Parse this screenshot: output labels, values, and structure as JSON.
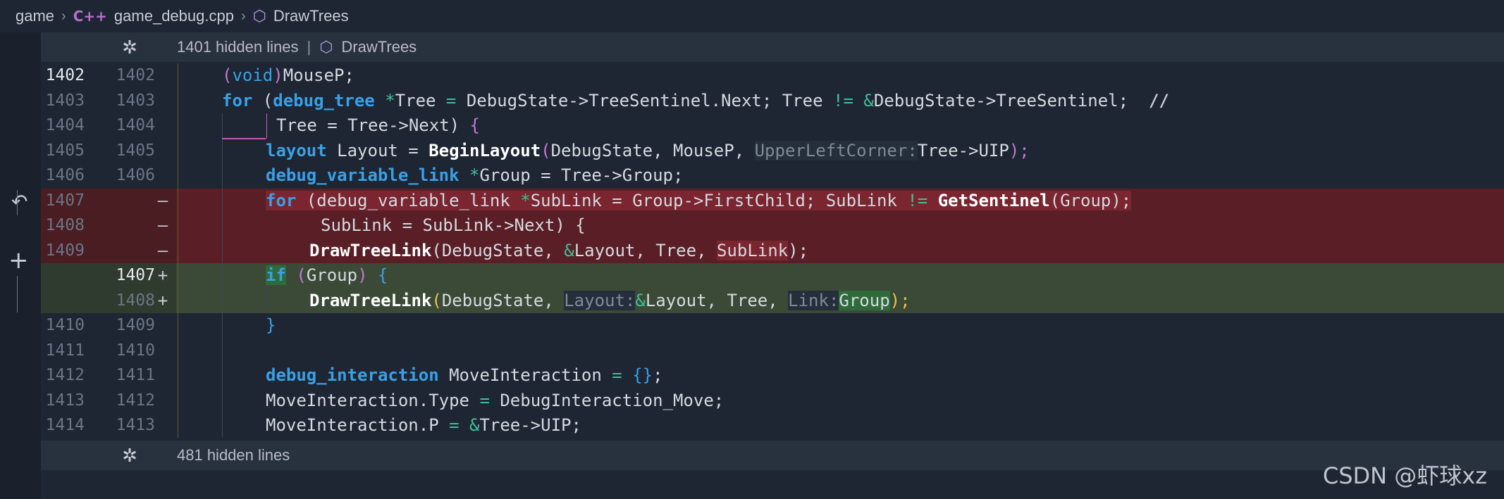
{
  "breadcrumb": {
    "folder": "game",
    "file_icon": "C++",
    "file": "game_debug.cpp",
    "symbol": "DrawTrees"
  },
  "fold_top": {
    "text": "1401 hidden lines",
    "separator": "|",
    "symbol": "DrawTrees"
  },
  "fold_bottom": {
    "text": "481 hidden lines"
  },
  "gutter_markers": {
    "deleted": "—",
    "added": "+"
  },
  "lines": [
    {
      "old": "1402",
      "new": "1402",
      "type": "ctx"
    },
    {
      "old": "1403",
      "new": "1403",
      "type": "ctx"
    },
    {
      "old": "1404",
      "new": "1404",
      "type": "ctx"
    },
    {
      "old": "1405",
      "new": "1405",
      "type": "ctx"
    },
    {
      "old": "1406",
      "new": "1406",
      "type": "ctx"
    },
    {
      "old": "1407",
      "new": "",
      "type": "del"
    },
    {
      "old": "1408",
      "new": "",
      "type": "del"
    },
    {
      "old": "1409",
      "new": "",
      "type": "del"
    },
    {
      "old": "",
      "new": "1407",
      "type": "add"
    },
    {
      "old": "",
      "new": "1408",
      "type": "add"
    },
    {
      "old": "1410",
      "new": "1409",
      "type": "ctx"
    },
    {
      "old": "1411",
      "new": "1410",
      "type": "ctx"
    },
    {
      "old": "1412",
      "new": "1411",
      "type": "ctx"
    },
    {
      "old": "1413",
      "new": "1412",
      "type": "ctx"
    },
    {
      "old": "1414",
      "new": "1413",
      "type": "ctx"
    }
  ],
  "code": {
    "l0": {
      "p1": "(",
      "p2": "void",
      "p3": ")",
      "p4": "MouseP;"
    },
    "l1": {
      "kw": "for",
      "p1": " (",
      "ty": "debug_tree",
      "p2": " ",
      "op1": "*",
      "p3": "Tree ",
      "op2": "=",
      "p4": " DebugState->TreeSentinel.Next; Tree ",
      "op3": "!=",
      "p5": " ",
      "op4": "&",
      "p6": "DebugState->TreeSentinel;  ",
      "cm": "//"
    },
    "l2": {
      "p1": "Tree = Tree->Next) ",
      "br": "{"
    },
    "l3": {
      "ty": "layout",
      "p1": " Layout = ",
      "fn": "BeginLayout",
      "p2": "(",
      "p3": "DebugState, MouseP, ",
      "hint": "UpperLeftCorner:",
      "p4": "Tree->UIP",
      "p5": ");"
    },
    "l4": {
      "ty": "debug_variable_link",
      "p1": " ",
      "op1": "*",
      "p2": "Group = Tree->Group;"
    },
    "l5": {
      "kw": "for",
      "p1": " (debug_variable_link ",
      "op1": "*",
      "p2": "SubLink = Group->FirstChild; SubLink ",
      "op2": "!=",
      "p3": " ",
      "fn": "GetSentinel",
      "p4": "(Group);"
    },
    "l6": {
      "p1": "SubLink = SubLink->Next) {"
    },
    "l7": {
      "fn": "DrawTreeLink",
      "p1": "(DebugState, ",
      "op1": "&",
      "p2": "Layout, Tree, ",
      "hl": "SubLink",
      "p3": ");"
    },
    "l8": {
      "kw": "if",
      "p1": " ",
      "pr1": "(",
      "p2": "Group",
      "pr2": ")",
      "p3": " ",
      "br": "{"
    },
    "l9": {
      "fn": "DrawTreeLink",
      "p1": "(",
      "p2": "DebugState, ",
      "hint1": "Layout:",
      "op1": "&",
      "p3": "Layout, Tree, ",
      "hint2": "Link:",
      "hl": "Group",
      "p4": ");"
    },
    "l10": {
      "br": "}"
    },
    "l11": {
      "p1": ""
    },
    "l12": {
      "ty": "debug_interaction",
      "p1": " MoveInteraction ",
      "op1": "=",
      "p2": " ",
      "br": "{}",
      "p3": ";"
    },
    "l13": {
      "p1": "MoveInteraction.Type ",
      "op1": "=",
      "p2": " DebugInteraction_Move;"
    },
    "l14": {
      "p1": "MoveInteraction.P ",
      "op1": "=",
      "p2": " ",
      "op2": "&",
      "p3": "Tree->UIP;"
    }
  },
  "watermark": "CSDN @虾球xz"
}
